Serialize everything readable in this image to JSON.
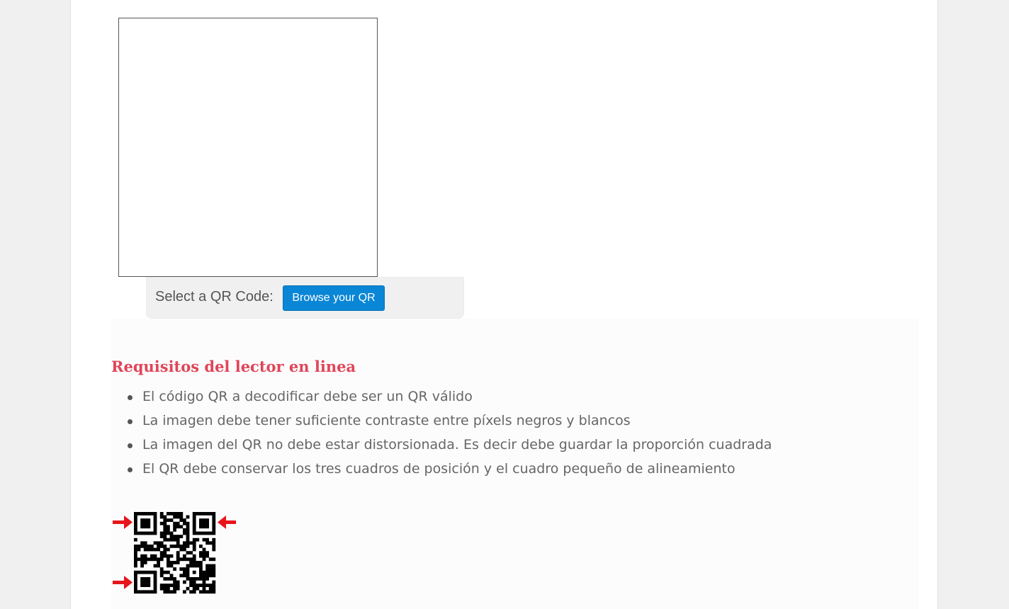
{
  "uploader": {
    "select_label": "Select a QR Code:",
    "browse_label": "Browse your QR"
  },
  "requirements": {
    "title": "Requisitos del lector en linea",
    "items": [
      "El código QR a decodificar debe ser un QR válido",
      "La imagen debe tener suficiente contraste entre píxels negros y blancos",
      "La imagen del QR no debe estar distorsionada. Es decir debe guardar la proporción cuadrada",
      "El QR debe conservar los tres cuadros de posición y el cuadro pequeño de alineamiento"
    ]
  },
  "figure": {
    "arrow_color": "#e8141c",
    "qr_color": "#000000",
    "icons": [
      "arrow-right-icon",
      "arrow-left-icon",
      "qr-code-icon"
    ]
  }
}
